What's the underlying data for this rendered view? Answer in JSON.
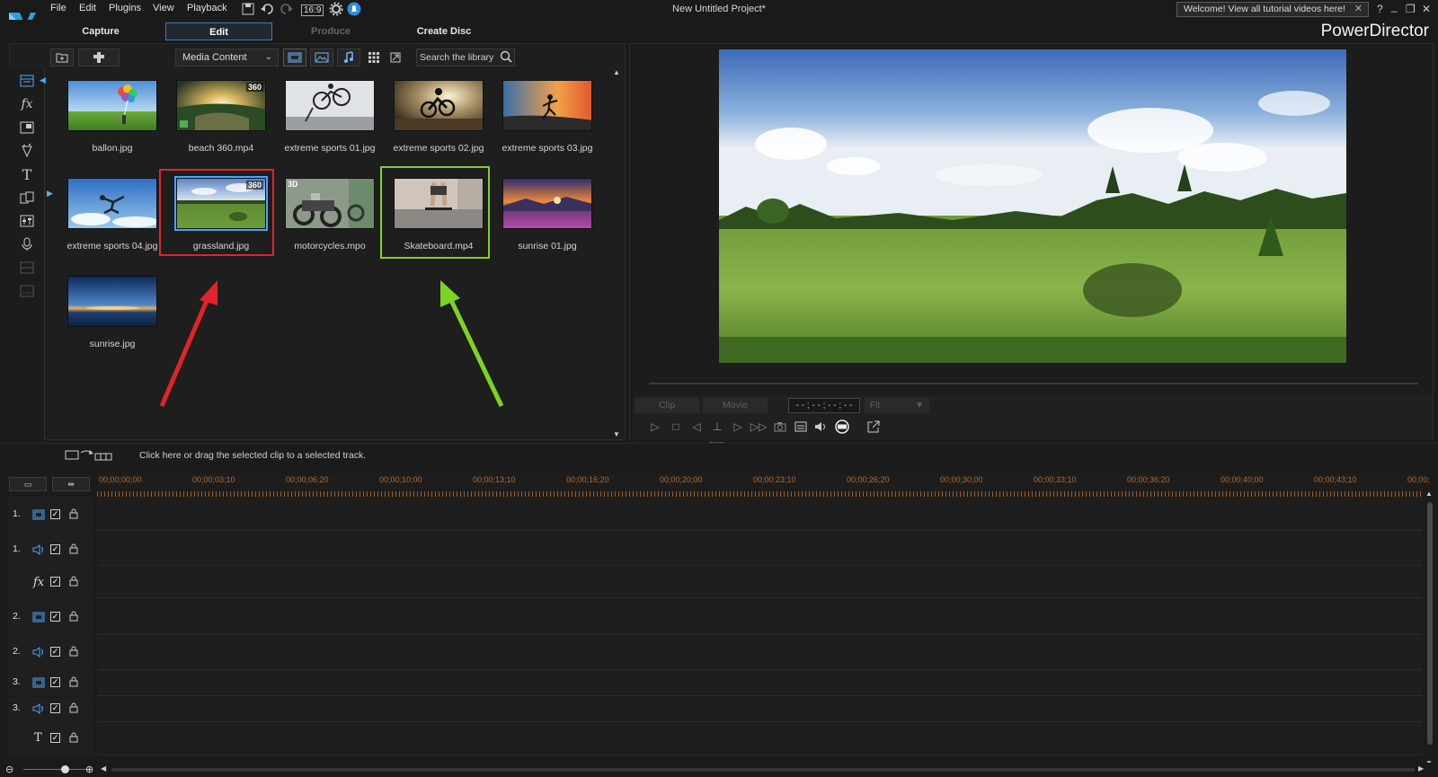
{
  "menu": [
    "File",
    "Edit",
    "Plugins",
    "View",
    "Playback"
  ],
  "aspect_ratio": "16:9",
  "project_title": "New Untitled Project*",
  "welcome_banner": "Welcome! View all tutorial videos here!",
  "window_buttons": {
    "help": "?",
    "minimize": "_",
    "restore": "❐",
    "close": "✕"
  },
  "modes": {
    "capture": "Capture",
    "edit": "Edit",
    "produce": "Produce",
    "create_disc": "Create Disc"
  },
  "brand": "PowerDirector",
  "library": {
    "media_select": "Media Content",
    "search_placeholder": "Search the library",
    "items": [
      {
        "label": "ballon.jpg",
        "badge": ""
      },
      {
        "label": "beach 360.mp4",
        "badge": "360"
      },
      {
        "label": "extreme sports 01.jpg",
        "badge": ""
      },
      {
        "label": "extreme sports 02.jpg",
        "badge": ""
      },
      {
        "label": "extreme sports 03.jpg",
        "badge": ""
      },
      {
        "label": "extreme sports 04.jpg",
        "badge": ""
      },
      {
        "label": "grassland.jpg",
        "badge": "360"
      },
      {
        "label": "motorcycles.mpo",
        "badge": "3D"
      },
      {
        "label": "Skateboard.mp4",
        "badge": ""
      },
      {
        "label": "sunrise 01.jpg",
        "badge": ""
      },
      {
        "label": "sunrise.jpg",
        "badge": ""
      }
    ]
  },
  "preview": {
    "clip_tab": "Clip",
    "movie_tab": "Movie",
    "timecode": "- - ; - - ; - - ; - -",
    "fit": "Fit"
  },
  "hint": "Click here or drag the selected clip to a selected track.",
  "ruler_labels": [
    "00;00;00;00",
    "00;00;03;10",
    "00;00;06;20",
    "00;00;10;00",
    "00;00;13;10",
    "00;00;16;20",
    "00;00;20;00",
    "00;00;23;10",
    "00;00;26;20",
    "00;00;30;00",
    "00;00;33;10",
    "00;00;36;20",
    "00;00;40;00",
    "00;00;43;10",
    "00;00;"
  ],
  "tracks": [
    {
      "num": "1.",
      "kind": "video"
    },
    {
      "num": "1.",
      "kind": "audio"
    },
    {
      "num": "",
      "kind": "fx"
    },
    {
      "num": "2.",
      "kind": "video"
    },
    {
      "num": "2.",
      "kind": "audio"
    },
    {
      "num": "3.",
      "kind": "video"
    },
    {
      "num": "3.",
      "kind": "audio"
    },
    {
      "num": "",
      "kind": "title"
    }
  ],
  "timeline_buttons": {
    "fit": "▭",
    "split": "⇹"
  },
  "colors": {
    "accent_blue": "#3b7fc4",
    "highlight_red": "#e2232a",
    "highlight_green": "#7ed321",
    "ruler_orange": "#b36a2b"
  }
}
